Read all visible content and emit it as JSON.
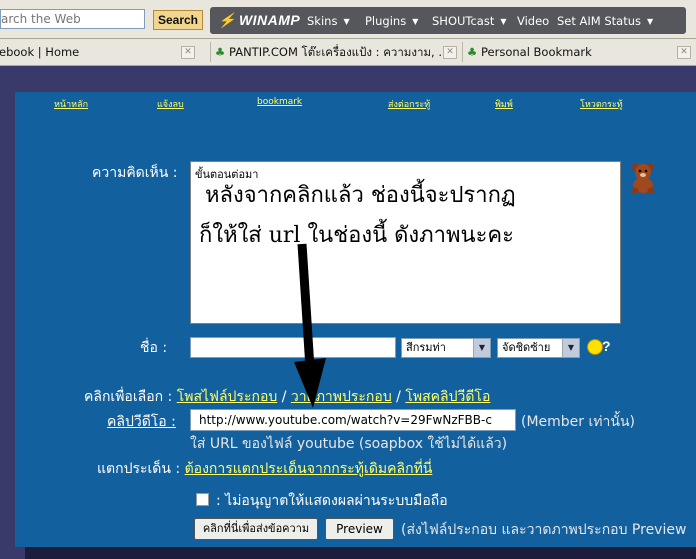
{
  "toolbar": {
    "search_placeholder": "arch the Web",
    "search_button": "Search",
    "winamp": "WINAMP",
    "menu": [
      "Skins",
      "Plugins",
      "SHOUTcast",
      "Video",
      "Set AIM Status"
    ]
  },
  "tabs": [
    {
      "label": "ebook | Home"
    },
    {
      "label": "PANTIP.COM โต๊ะเครื่องแป้ง : ความงาม, ..."
    },
    {
      "label": "Personal Bookmark"
    }
  ],
  "nav": [
    "หน้าหลัก",
    "แจ้งลบ",
    "bookmark",
    "ส่งต่อกระทู้",
    "พิมพ์",
    "โหวตกระทู้"
  ],
  "form": {
    "comment_label": "ความคิดเห็น :",
    "comment_hint": "ขั้นตอนต่อมา",
    "overlay_line1": "หลังจากคลิกแล้ว ช่องนี้จะปรากฏ",
    "overlay_line2": "ก็ให้ใส่ url ในช่องนี้ ดังภาพนะคะ",
    "name_label": "ชื่อ :",
    "color_select": "สีกรมท่า",
    "align_select": "จัดชิดซ้าย",
    "smiley_q": "?",
    "choose_label": "คลิกเพื่อเลือก :",
    "choose_links": [
      "โพสไฟล์ประกอบ",
      "วาดภาพประกอบ",
      "โพสคลิปวีดีโอ"
    ],
    "choose_sep": "/",
    "clip_label": "คลิปวีดีโอ :",
    "clip_url": "http://www.youtube.com/watch?v=29FwNzFBB-c",
    "member_note": "(Member เท่านั้น)",
    "url_note": "ใส่ URL ของไฟล์ youtube (soapbox ใช้ไม่ได้แล้ว)",
    "branch_label": "แตกประเด็น :",
    "branch_link": "ต้องการแตกประเด็นจากกระทู้เดิมคลิกที่นี่",
    "mobile_label": ": ไม่อนุญาตให้แสดงผลผ่านระบบมือถือ",
    "submit_button": "คลิกที่นี่เพื่อส่งข้อความ",
    "preview_button": "Preview",
    "preview_note": "(ส่งไฟล์ประกอบ และวาดภาพประกอบ Preview"
  },
  "colors": {
    "panel": "#13609f",
    "link": "#ffff66",
    "page_bg": "#3a3a6a"
  }
}
